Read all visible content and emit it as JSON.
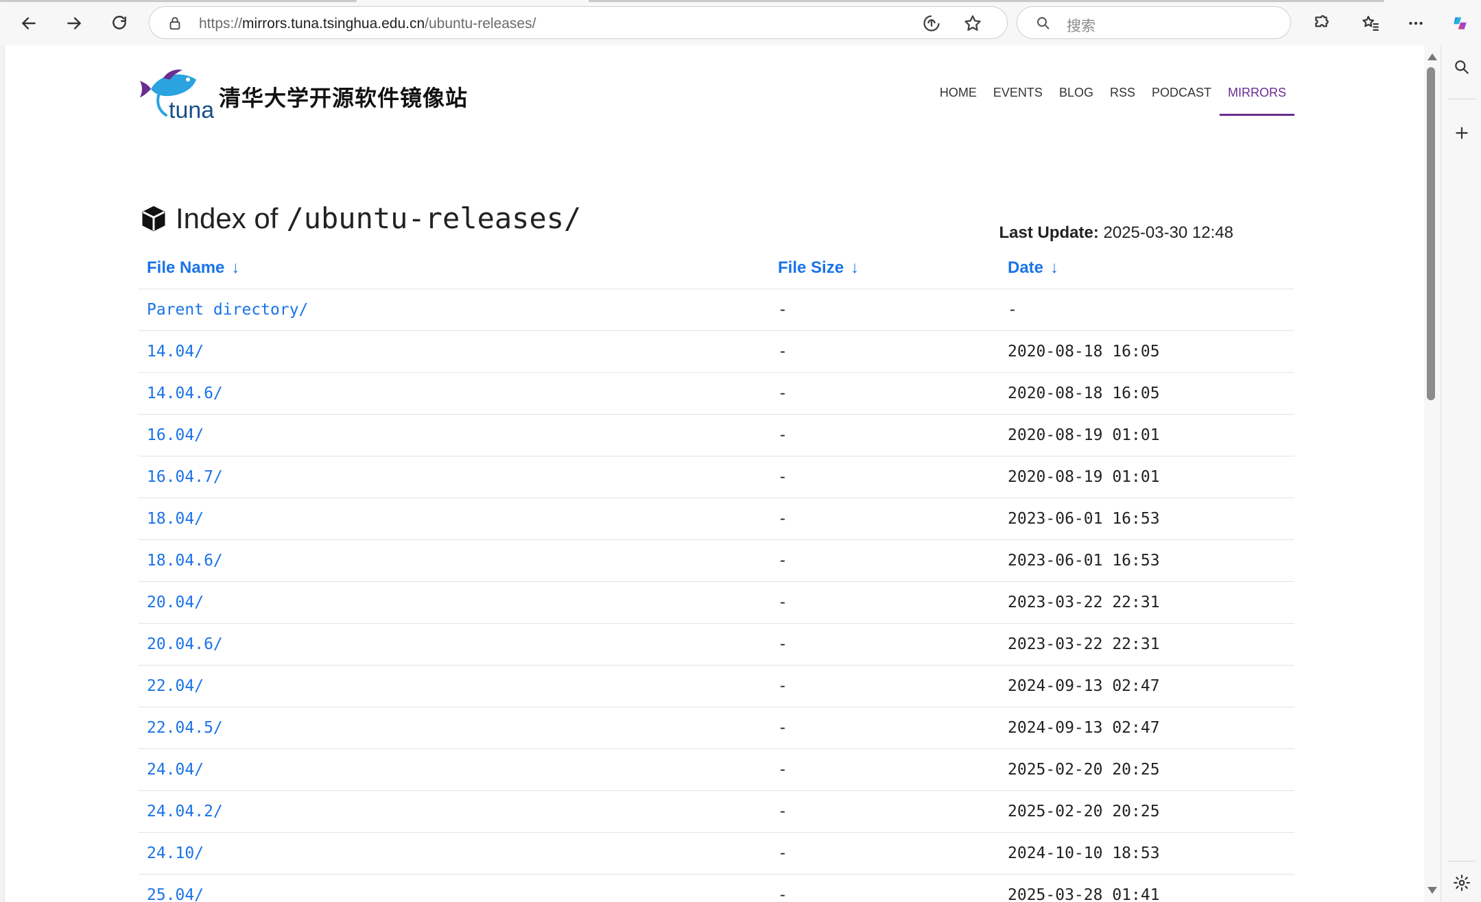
{
  "browser": {
    "url_prefix": "https://",
    "url_host": "mirrors.tuna.tsinghua.edu.cn",
    "url_path": "/ubuntu-releases/",
    "search_placeholder": "搜索"
  },
  "site": {
    "title": "清华大学开源软件镜像站",
    "logo_text": "tuna",
    "nav": [
      {
        "label": "HOME"
      },
      {
        "label": "EVENTS"
      },
      {
        "label": "BLOG"
      },
      {
        "label": "RSS"
      },
      {
        "label": "PODCAST"
      },
      {
        "label": "MIRRORS",
        "active": true
      }
    ]
  },
  "index": {
    "title_prefix": "Index of",
    "title_path": "/ubuntu-releases/",
    "last_update_label": "Last Update:",
    "last_update_value": "2025-03-30 12:48",
    "columns": [
      "File Name",
      "File Size",
      "Date"
    ],
    "sort_arrow": "↓",
    "rows": [
      {
        "name": "Parent directory/",
        "size": "-",
        "date": "-"
      },
      {
        "name": "14.04/",
        "size": "-",
        "date": "2020-08-18 16:05"
      },
      {
        "name": "14.04.6/",
        "size": "-",
        "date": "2020-08-18 16:05"
      },
      {
        "name": "16.04/",
        "size": "-",
        "date": "2020-08-19 01:01"
      },
      {
        "name": "16.04.7/",
        "size": "-",
        "date": "2020-08-19 01:01"
      },
      {
        "name": "18.04/",
        "size": "-",
        "date": "2023-06-01 16:53"
      },
      {
        "name": "18.04.6/",
        "size": "-",
        "date": "2023-06-01 16:53"
      },
      {
        "name": "20.04/",
        "size": "-",
        "date": "2023-03-22 22:31"
      },
      {
        "name": "20.04.6/",
        "size": "-",
        "date": "2023-03-22 22:31"
      },
      {
        "name": "22.04/",
        "size": "-",
        "date": "2024-09-13 02:47"
      },
      {
        "name": "22.04.5/",
        "size": "-",
        "date": "2024-09-13 02:47"
      },
      {
        "name": "24.04/",
        "size": "-",
        "date": "2025-02-20 20:25"
      },
      {
        "name": "24.04.2/",
        "size": "-",
        "date": "2025-02-20 20:25"
      },
      {
        "name": "24.10/",
        "size": "-",
        "date": "2024-10-10 18:53"
      },
      {
        "name": "25.04/",
        "size": "-",
        "date": "2025-03-28 01:41"
      }
    ]
  },
  "colors": {
    "link": "#1a73e8",
    "nav_active": "#6a2c91",
    "logo_blue": "#2aa3e0",
    "logo_purple": "#6a2c91"
  }
}
